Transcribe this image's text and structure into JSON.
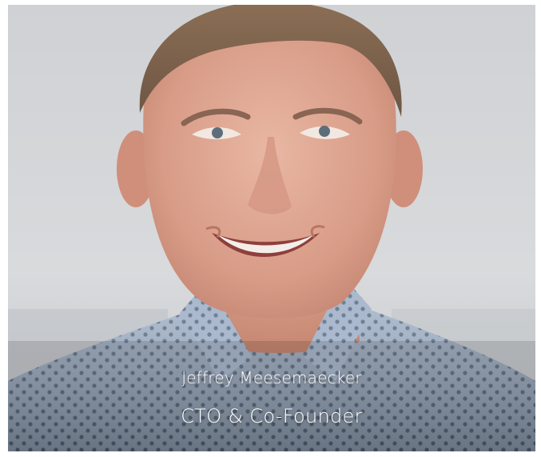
{
  "profile": {
    "name": "Jeffrey Meesemaecker",
    "title": "CTO & Co-Founder"
  }
}
